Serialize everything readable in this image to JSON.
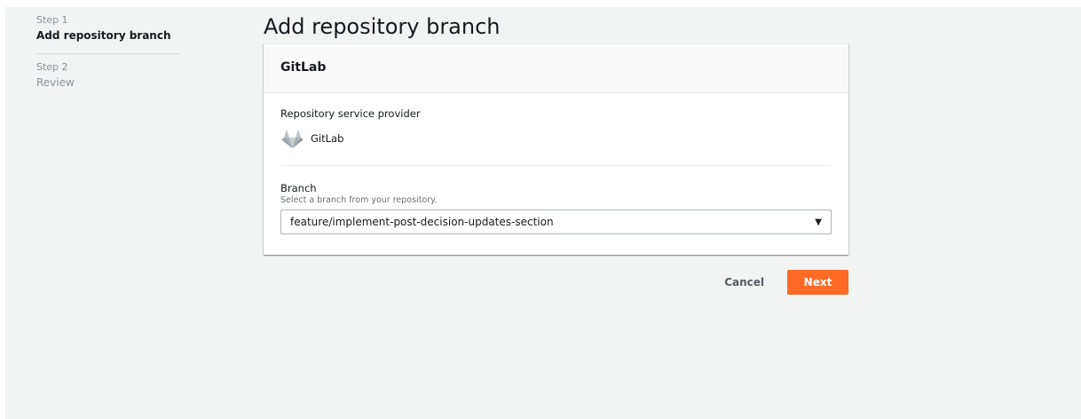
{
  "steps": [
    {
      "number": "Step 1",
      "title": "Add repository branch",
      "state": "current"
    },
    {
      "number": "Step 2",
      "title": "Review",
      "state": "disabled"
    }
  ],
  "page": {
    "title": "Add repository branch"
  },
  "card": {
    "title": "GitLab",
    "provider": {
      "label": "Repository service provider",
      "name": "GitLab",
      "icon": "gitlab-icon"
    },
    "branch": {
      "label": "Branch",
      "description": "Select a branch from your repository.",
      "selected": "feature/implement-post-decision-updates-section"
    }
  },
  "actions": {
    "cancel": "Cancel",
    "next": "Next"
  },
  "colors": {
    "primary": "#ff6b26",
    "background": "#f2f3f3",
    "text": "#16191f",
    "muted": "#879596"
  }
}
